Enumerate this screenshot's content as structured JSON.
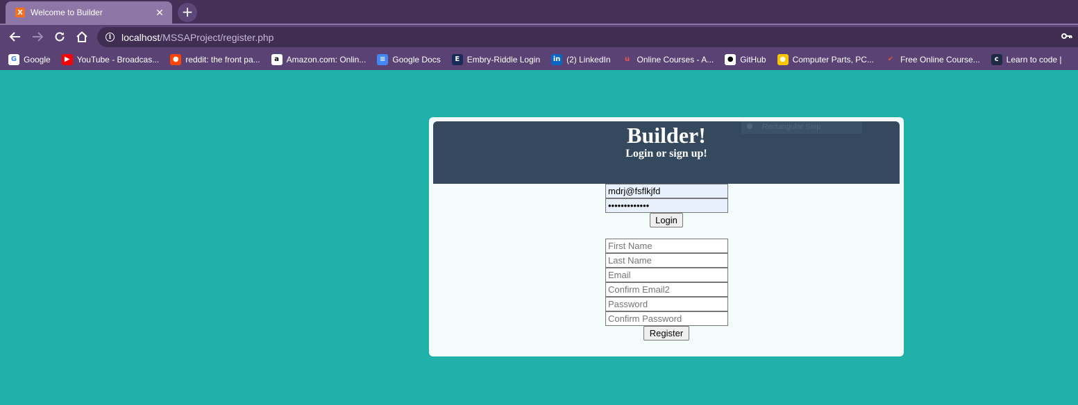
{
  "browser": {
    "tab_title": "Welcome to Builder",
    "favicon_letter": "X",
    "url_host": "localhost",
    "url_path": "/MSSAProject/register.php",
    "bookmarks": [
      {
        "label": "Google",
        "icon": "google-icon",
        "color": "#ffffff",
        "glyph": "G",
        "glyph_color": "#4285f4"
      },
      {
        "label": "YouTube - Broadcas...",
        "icon": "youtube-icon",
        "color": "#ff0000",
        "glyph": "▶",
        "glyph_color": "#ffffff"
      },
      {
        "label": "reddit: the front pa...",
        "icon": "reddit-icon",
        "color": "#ff4500",
        "glyph": "●",
        "glyph_color": "#ffffff"
      },
      {
        "label": "Amazon.com: Onlin...",
        "icon": "amazon-icon",
        "color": "#ffffff",
        "glyph": "a",
        "glyph_color": "#000000"
      },
      {
        "label": "Google Docs",
        "icon": "google-docs-icon",
        "color": "#4285f4",
        "glyph": "≡",
        "glyph_color": "#ffffff"
      },
      {
        "label": "Embry-Riddle Login",
        "icon": "embry-riddle-icon",
        "color": "#1a2b5a",
        "glyph": "E",
        "glyph_color": "#ffffff"
      },
      {
        "label": "(2) LinkedIn",
        "icon": "linkedin-icon",
        "color": "#0a66c2",
        "glyph": "in",
        "glyph_color": "#ffffff"
      },
      {
        "label": "Online Courses - A...",
        "icon": "udemy-icon",
        "color": "transparent",
        "glyph": "u",
        "glyph_color": "#ec5252"
      },
      {
        "label": "GitHub",
        "icon": "github-icon",
        "color": "#ffffff",
        "glyph": "●",
        "glyph_color": "#000000"
      },
      {
        "label": "Computer Parts, PC...",
        "icon": "newegg-icon",
        "color": "#f7c600",
        "glyph": "●",
        "glyph_color": "#fffbe0"
      },
      {
        "label": "Free Online Course...",
        "icon": "edx-icon",
        "color": "transparent",
        "glyph": "✔",
        "glyph_color": "#e4572e"
      },
      {
        "label": "Learn to code |",
        "icon": "codecademy-icon",
        "color": "#1f2a44",
        "glyph": "c",
        "glyph_color": "#ffffff"
      }
    ]
  },
  "header": {
    "title": "Builder!",
    "subtitle": "Login or sign up!",
    "snip_label": "Rectangular Snip"
  },
  "login": {
    "email_value": "mdrj@fsflkjfd",
    "password_value": "•••••••••••••",
    "button_label": "Login"
  },
  "register": {
    "first_name_placeholder": "First Name",
    "last_name_placeholder": "Last Name",
    "email_placeholder": "Email",
    "confirm_email_placeholder": "Confirm Email2",
    "password_placeholder": "Password",
    "confirm_password_placeholder": "Confirm Password",
    "button_label": "Register"
  }
}
